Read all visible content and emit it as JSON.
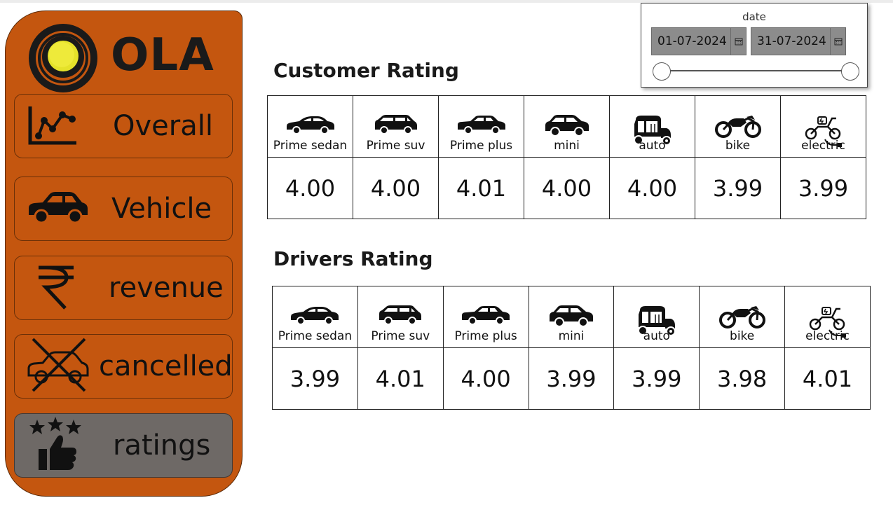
{
  "brand": {
    "name": "OLA",
    "ring_color": "#1a1a1a",
    "dot_color": "#e5e22a"
  },
  "colors": {
    "sidebar": "#c4560f",
    "active_button": "#6e6966"
  },
  "nav": [
    {
      "label": "Overall",
      "icon": "line-chart-icon",
      "active": false
    },
    {
      "label": "Vehicle",
      "icon": "car-icon",
      "active": false
    },
    {
      "label": "revenue",
      "icon": "rupee-icon",
      "active": false
    },
    {
      "label": "cancelled",
      "icon": "cancelled-car-icon",
      "active": false
    },
    {
      "label": "ratings",
      "icon": "star-thumbs-up-icon",
      "active": true
    }
  ],
  "date_slicer": {
    "title": "date",
    "start": "01-07-2024",
    "end": "31-07-2024",
    "range_fraction": [
      0,
      1
    ]
  },
  "customer_rating": {
    "title": "Customer Rating",
    "vehicles": [
      "Prime sedan",
      "Prime suv",
      "Prime plus",
      "mini",
      "auto",
      "bike",
      "electric"
    ],
    "values": [
      "4.00",
      "4.00",
      "4.01",
      "4.00",
      "4.00",
      "3.99",
      "3.99"
    ]
  },
  "drivers_rating": {
    "title": "Drivers Rating",
    "vehicles": [
      "Prime sedan",
      "Prime suv",
      "Prime plus",
      "mini",
      "auto",
      "bike",
      "electric"
    ],
    "values": [
      "3.99",
      "4.01",
      "4.00",
      "3.99",
      "3.99",
      "3.98",
      "4.01"
    ]
  },
  "vehicle_icons": [
    "sedan-icon",
    "suv-icon",
    "prime-plus-car-icon",
    "mini-car-icon",
    "auto-rickshaw-icon",
    "motorbike-icon",
    "electric-scooter-icon"
  ]
}
